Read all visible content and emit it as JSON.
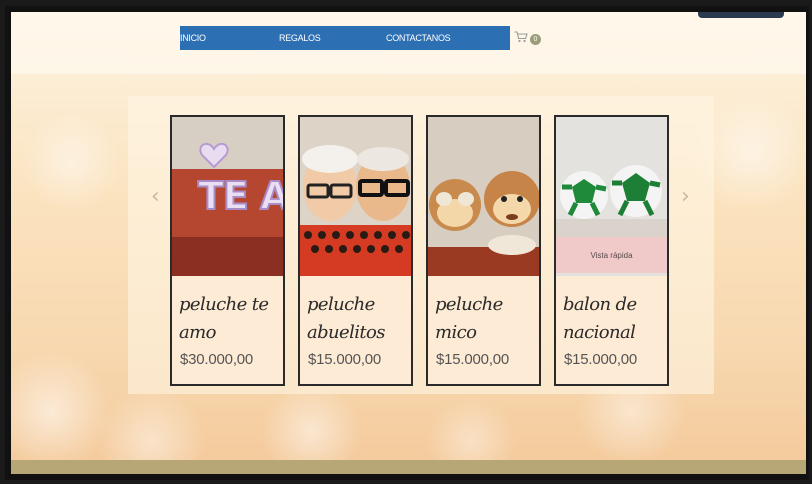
{
  "nav": {
    "items": [
      {
        "label": "INICIO"
      },
      {
        "label": "REGALOS"
      },
      {
        "label": "CONTACTANOS"
      }
    ],
    "cart_count": "0"
  },
  "products": [
    {
      "name": "peluche te amo",
      "price": "$30.000,00",
      "image_text": "TE AMO"
    },
    {
      "name": "peluche abuelitos",
      "price": "$15.000,00"
    },
    {
      "name": "peluche mico",
      "price": "$15.000,00"
    },
    {
      "name": "balon de nacional",
      "price": "$15.000,00",
      "quick_view": "Vista rápida"
    }
  ],
  "colors": {
    "nav_bg": "#2d6fb3",
    "card_bg": "#fdebd5",
    "quick_view_bg": "#f0c9c9",
    "footer_strip": "#b7a777"
  },
  "icons": {
    "cart": "cart-icon",
    "prev": "chevron-left-icon",
    "next": "chevron-right-icon"
  }
}
